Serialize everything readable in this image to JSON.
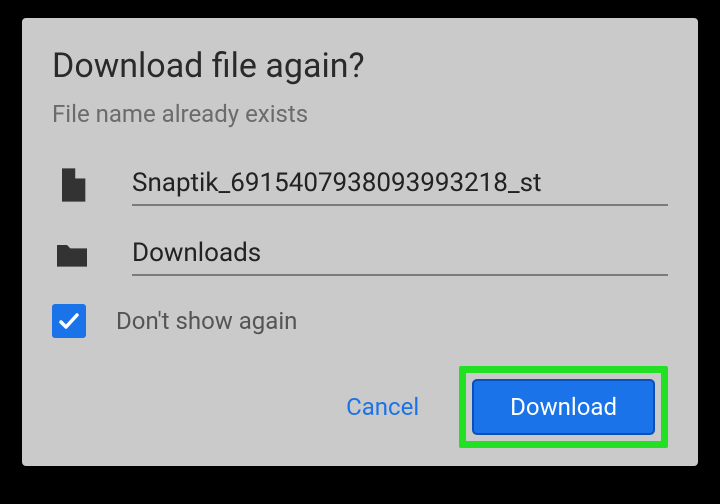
{
  "dialog": {
    "title": "Download file again?",
    "subtitle": "File name already exists",
    "filename": "Snaptik_6915407938093993218_st",
    "folder": "Downloads",
    "dont_show_label": "Don't show again",
    "dont_show_checked": true,
    "cancel_label": "Cancel",
    "download_label": "Download",
    "highlight_color": "#22e024",
    "primary_color": "#1a73e8"
  }
}
